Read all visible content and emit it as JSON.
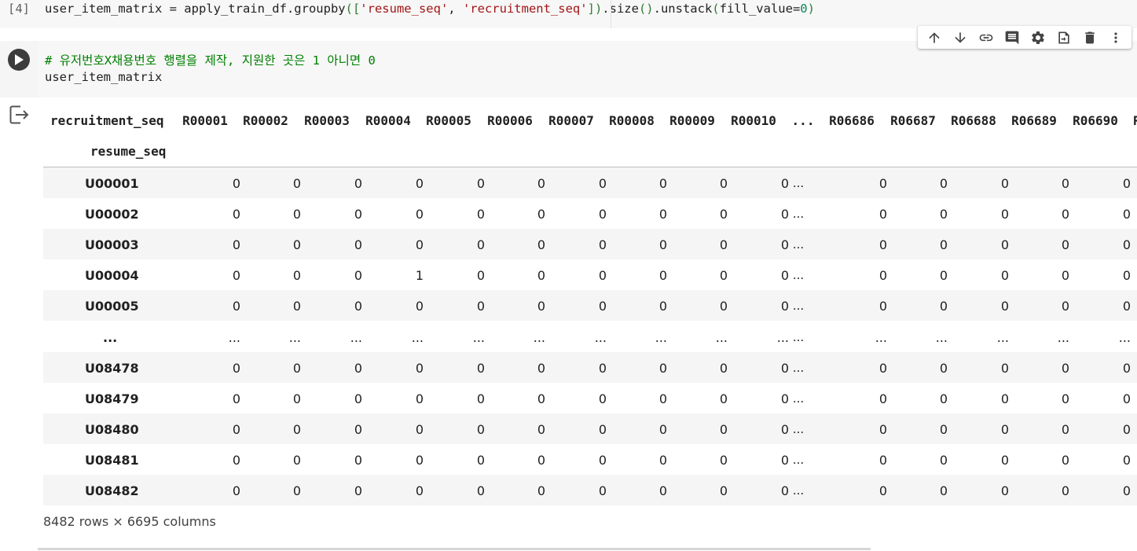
{
  "prev_cell": {
    "prompt": "[4]",
    "code_parts": [
      {
        "t": "user_item_matrix = apply_train_df.groupby",
        "c": "plain"
      },
      {
        "t": "(",
        "c": "paren"
      },
      {
        "t": "[",
        "c": "paren"
      },
      {
        "t": "'resume_seq'",
        "c": "str"
      },
      {
        "t": ", ",
        "c": "plain"
      },
      {
        "t": "'recruitment_seq'",
        "c": "str"
      },
      {
        "t": "]",
        "c": "paren"
      },
      {
        "t": ")",
        "c": "paren"
      },
      {
        "t": ".size",
        "c": "plain"
      },
      {
        "t": "()",
        "c": "paren"
      },
      {
        "t": ".unstack",
        "c": "plain"
      },
      {
        "t": "(",
        "c": "paren"
      },
      {
        "t": "fill_value=",
        "c": "plain"
      },
      {
        "t": "0",
        "c": "num"
      },
      {
        "t": ")",
        "c": "paren"
      }
    ]
  },
  "cell": {
    "comment": "# 유저번호X채용번호 행렬을 제작, 지원한 곳은 1 아니면 0",
    "line2": "user_item_matrix"
  },
  "toolbar": [
    {
      "name": "move-up-icon"
    },
    {
      "name": "move-down-icon"
    },
    {
      "name": "link-icon"
    },
    {
      "name": "comment-icon"
    },
    {
      "name": "gear-icon"
    },
    {
      "name": "mirror-cell-icon"
    },
    {
      "name": "delete-icon"
    },
    {
      "name": "more-vert-icon"
    }
  ],
  "dataframe": {
    "columns_name": "recruitment_seq",
    "index_name": "resume_seq",
    "columns": [
      "R00001",
      "R00002",
      "R00003",
      "R00004",
      "R00005",
      "R00006",
      "R00007",
      "R00008",
      "R00009",
      "R00010",
      "...",
      "R06686",
      "R06687",
      "R06688",
      "R06689",
      "R06690",
      "R"
    ],
    "rows": [
      {
        "label": "U00001",
        "values": [
          "0",
          "0",
          "0",
          "0",
          "0",
          "0",
          "0",
          "0",
          "0",
          "0",
          "...",
          "0",
          "0",
          "0",
          "0",
          "0"
        ]
      },
      {
        "label": "U00002",
        "values": [
          "0",
          "0",
          "0",
          "0",
          "0",
          "0",
          "0",
          "0",
          "0",
          "0",
          "...",
          "0",
          "0",
          "0",
          "0",
          "0"
        ]
      },
      {
        "label": "U00003",
        "values": [
          "0",
          "0",
          "0",
          "0",
          "0",
          "0",
          "0",
          "0",
          "0",
          "0",
          "...",
          "0",
          "0",
          "0",
          "0",
          "0"
        ]
      },
      {
        "label": "U00004",
        "values": [
          "0",
          "0",
          "0",
          "1",
          "0",
          "0",
          "0",
          "0",
          "0",
          "0",
          "...",
          "0",
          "0",
          "0",
          "0",
          "0"
        ]
      },
      {
        "label": "U00005",
        "values": [
          "0",
          "0",
          "0",
          "0",
          "0",
          "0",
          "0",
          "0",
          "0",
          "0",
          "...",
          "0",
          "0",
          "0",
          "0",
          "0"
        ]
      },
      {
        "label": "...",
        "values": [
          "...",
          "...",
          "...",
          "...",
          "...",
          "...",
          "...",
          "...",
          "...",
          "...",
          "...",
          "...",
          "...",
          "...",
          "...",
          "..."
        ]
      },
      {
        "label": "U08478",
        "values": [
          "0",
          "0",
          "0",
          "0",
          "0",
          "0",
          "0",
          "0",
          "0",
          "0",
          "...",
          "0",
          "0",
          "0",
          "0",
          "0"
        ]
      },
      {
        "label": "U08479",
        "values": [
          "0",
          "0",
          "0",
          "0",
          "0",
          "0",
          "0",
          "0",
          "0",
          "0",
          "...",
          "0",
          "0",
          "0",
          "0",
          "0"
        ]
      },
      {
        "label": "U08480",
        "values": [
          "0",
          "0",
          "0",
          "0",
          "0",
          "0",
          "0",
          "0",
          "0",
          "0",
          "...",
          "0",
          "0",
          "0",
          "0",
          "0"
        ]
      },
      {
        "label": "U08481",
        "values": [
          "0",
          "0",
          "0",
          "0",
          "0",
          "0",
          "0",
          "0",
          "0",
          "0",
          "...",
          "0",
          "0",
          "0",
          "0",
          "0"
        ]
      },
      {
        "label": "U08482",
        "values": [
          "0",
          "0",
          "0",
          "0",
          "0",
          "0",
          "0",
          "0",
          "0",
          "0",
          "...",
          "0",
          "0",
          "0",
          "0",
          "0"
        ]
      }
    ],
    "footer": "8482 rows × 6695 columns"
  }
}
